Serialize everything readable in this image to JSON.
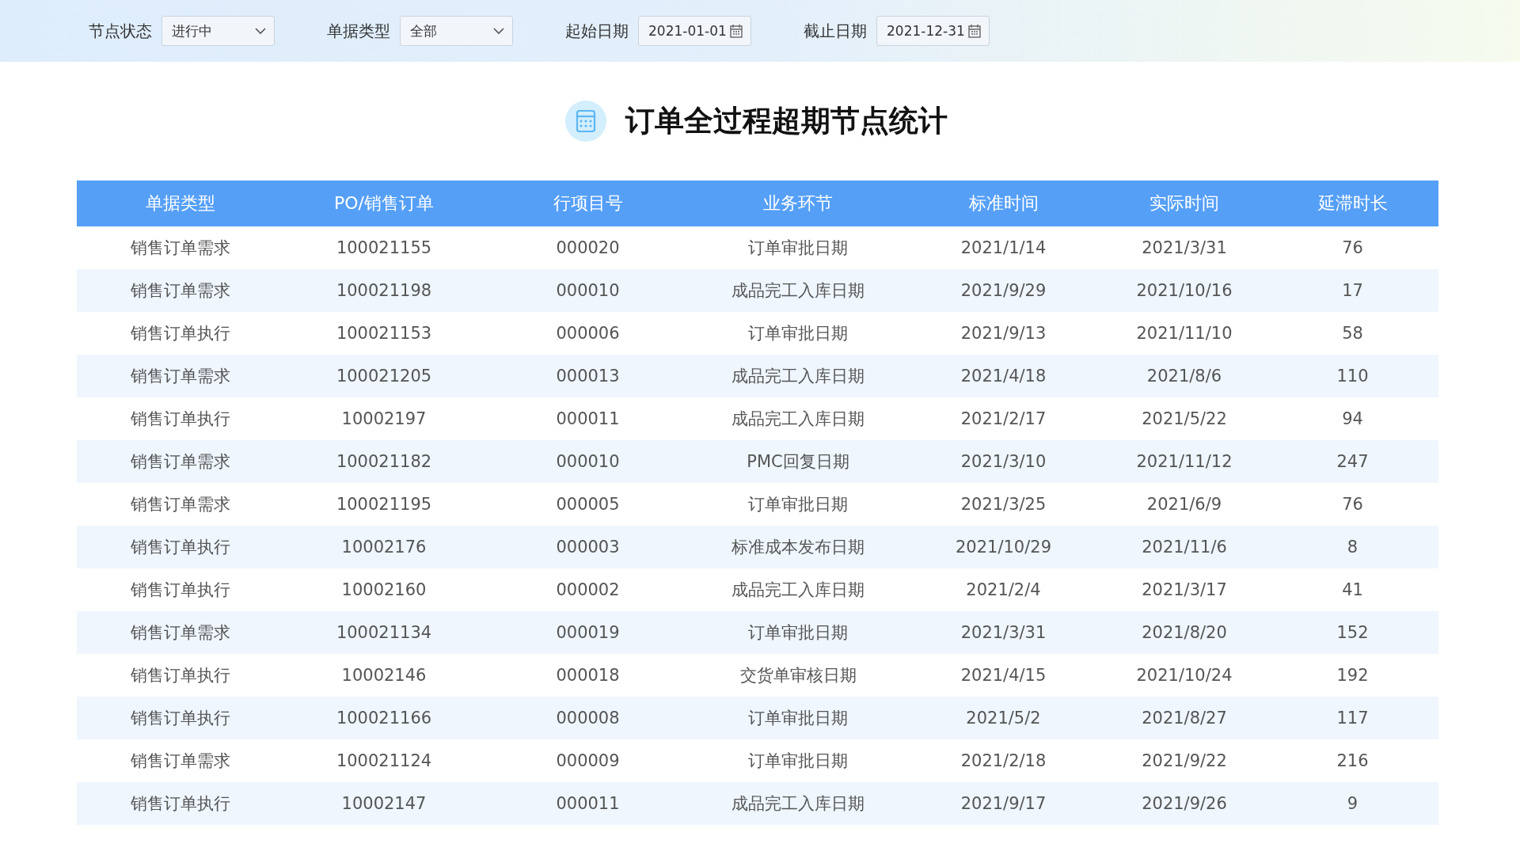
{
  "filters": [
    {
      "kind": "select",
      "label": "节点状态",
      "value": "进行中"
    },
    {
      "kind": "select",
      "label": "单据类型",
      "value": "全部"
    },
    {
      "kind": "date",
      "label": "起始日期",
      "value": "2021-01-01"
    },
    {
      "kind": "date",
      "label": "截止日期",
      "value": "2021-12-31"
    }
  ],
  "title": "订单全过程超期节点统计",
  "table": {
    "columns": [
      "单据类型",
      "PO/销售订单",
      "行项目号",
      "业务环节",
      "标准时间",
      "实际时间",
      "延滞时长"
    ],
    "rows": [
      [
        "销售订单需求",
        "100021155",
        "000020",
        "订单审批日期",
        "2021/1/14",
        "2021/3/31",
        "76"
      ],
      [
        "销售订单需求",
        "100021198",
        "000010",
        "成品完工入库日期",
        "2021/9/29",
        "2021/10/16",
        "17"
      ],
      [
        "销售订单执行",
        "100021153",
        "000006",
        "订单审批日期",
        "2021/9/13",
        "2021/11/10",
        "58"
      ],
      [
        "销售订单需求",
        "100021205",
        "000013",
        "成品完工入库日期",
        "2021/4/18",
        "2021/8/6",
        "110"
      ],
      [
        "销售订单执行",
        "10002197",
        "000011",
        "成品完工入库日期",
        "2021/2/17",
        "2021/5/22",
        "94"
      ],
      [
        "销售订单需求",
        "100021182",
        "000010",
        "PMC回复日期",
        "2021/3/10",
        "2021/11/12",
        "247"
      ],
      [
        "销售订单需求",
        "100021195",
        "000005",
        "订单审批日期",
        "2021/3/25",
        "2021/6/9",
        "76"
      ],
      [
        "销售订单执行",
        "10002176",
        "000003",
        "标准成本发布日期",
        "2021/10/29",
        "2021/11/6",
        "8"
      ],
      [
        "销售订单执行",
        "10002160",
        "000002",
        "成品完工入库日期",
        "2021/2/4",
        "2021/3/17",
        "41"
      ],
      [
        "销售订单需求",
        "100021134",
        "000019",
        "订单审批日期",
        "2021/3/31",
        "2021/8/20",
        "152"
      ],
      [
        "销售订单执行",
        "10002146",
        "000018",
        "交货单审核日期",
        "2021/4/15",
        "2021/10/24",
        "192"
      ],
      [
        "销售订单执行",
        "100021166",
        "000008",
        "订单审批日期",
        "2021/5/2",
        "2021/8/27",
        "117"
      ],
      [
        "销售订单需求",
        "100021124",
        "000009",
        "订单审批日期",
        "2021/2/18",
        "2021/9/22",
        "216"
      ],
      [
        "销售订单执行",
        "10002147",
        "000011",
        "成品完工入库日期",
        "2021/9/17",
        "2021/9/26",
        "9"
      ]
    ]
  }
}
